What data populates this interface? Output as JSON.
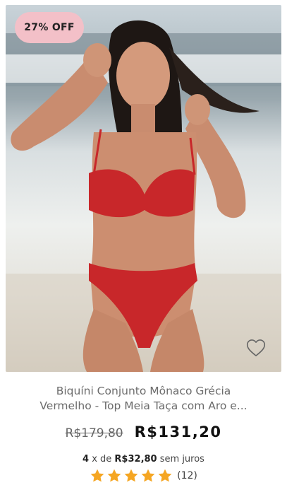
{
  "product": {
    "badge": "27% OFF",
    "title": "Biquíni Conjunto Mônaco Grécia\nVermelho - Top Meia Taça com Aro e...",
    "old_price": "R$179,80",
    "price": "R$131,20",
    "installments": {
      "count": "4",
      "x_de": "x de",
      "value": "R$32,80",
      "suffix": "sem juros"
    },
    "rating": {
      "stars": 5,
      "count": "(12)"
    }
  },
  "colors": {
    "badge_bg": "#f3c0c8",
    "star": "#f5a623",
    "swimsuit": "#c8272a"
  },
  "icons": {
    "favorite": "heart-outline-icon",
    "star": "star-icon"
  }
}
